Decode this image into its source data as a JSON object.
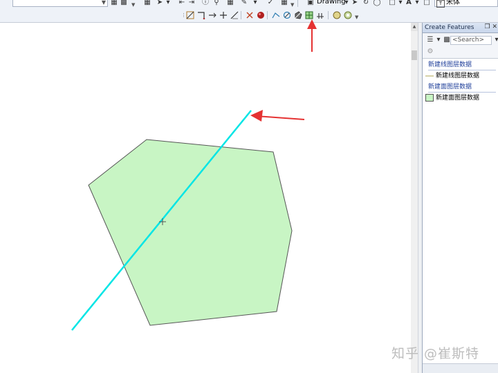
{
  "toolbar": {
    "drawing_label": "Drawing",
    "font_name": "宋体"
  },
  "create_features": {
    "title": "Create Features",
    "title_icons": "❒ ✕",
    "search_placeholder": "<Search>",
    "groups": [
      {
        "header": "新建线图层数据",
        "items": [
          {
            "label": "新建线图层数据",
            "symbol": "line",
            "color": "#c9c38a"
          }
        ]
      },
      {
        "header": "新建面图层数据",
        "items": [
          {
            "label": "新建面图层数据",
            "symbol": "polygon",
            "color": "#c8f5c4",
            "selected": true
          }
        ]
      }
    ]
  },
  "map": {
    "polygon_fill": "#c8f5c4",
    "polygon_stroke": "#555555",
    "cut_line_color": "#00e5e5",
    "annotation_arrow_color": "#e53232"
  },
  "watermark": "知乎 @崔斯特"
}
